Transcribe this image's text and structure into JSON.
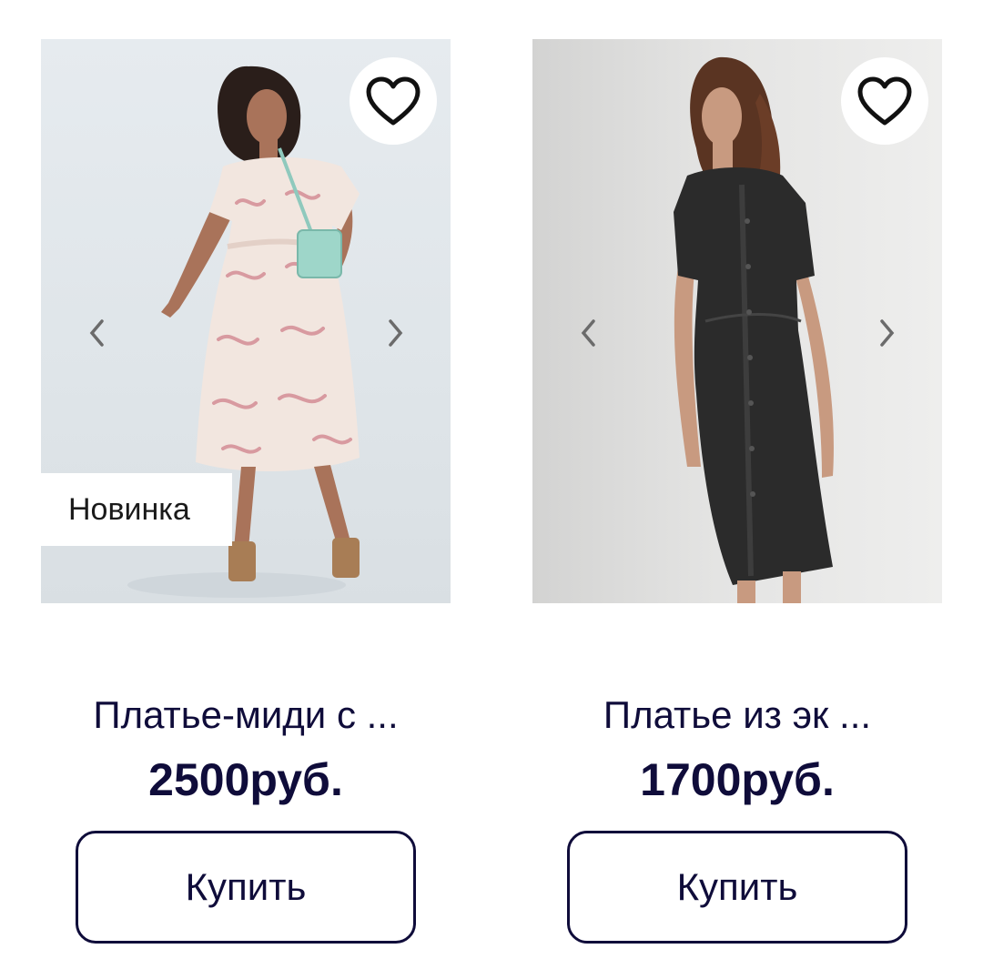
{
  "products": [
    {
      "title": "Платье-миди с ...",
      "price": "2500руб.",
      "badge": "Новинка",
      "buy_label": "Купить",
      "image_alt": "Женщина в светлом платье-миди с цветочным принтом и мятной сумкой",
      "favorite_icon": "heart-outline-icon",
      "prev_icon": "chevron-left-icon",
      "next_icon": "chevron-right-icon"
    },
    {
      "title": "Платье из эк ...",
      "price": "1700руб.",
      "buy_label": "Купить",
      "image_alt": "Женщина в чёрном платье из экокожи на пуговицах",
      "favorite_icon": "heart-outline-icon",
      "prev_icon": "chevron-left-icon",
      "next_icon": "chevron-right-icon"
    }
  ],
  "colors": {
    "text": "#0f0c3a",
    "button_border": "#0f0c3a",
    "background": "#ffffff",
    "badge_bg": "#ffffff"
  }
}
